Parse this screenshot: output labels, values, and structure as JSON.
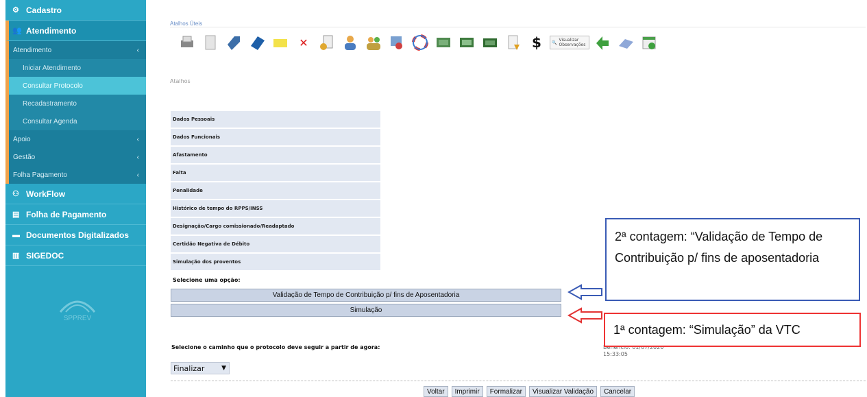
{
  "sidebar": {
    "cadastro": "Cadastro",
    "atendimento": "Atendimento",
    "sub_atendimento": "Atendimento",
    "iniciar": "Iniciar Atendimento",
    "consultar_protocolo": "Consultar Protocolo",
    "recadastramento": "Recadastramento",
    "consultar_agenda": "Consultar Agenda",
    "apoio": "Apoio",
    "gestao": "Gestão",
    "folha_pagamento_sub": "Folha Pagamento",
    "workflow": "WorkFlow",
    "folha_pagamento": "Folha de Pagamento",
    "documentos": "Documentos Digitalizados",
    "sigedoc": "SIGEDOC",
    "logo_text": "SPPREV"
  },
  "shortcuts": {
    "title": "Atalhos Úteis",
    "visualizar_label": "Visualizar Observações"
  },
  "atalhos_label": "Atalhos",
  "rows": [
    "Dados Pessoais",
    "Dados Funcionais",
    "Afastamento",
    "Falta",
    "Penalidade",
    "Histórico de tempo do RPPS/INSS",
    "Designação/Cargo comissionado/Readaptado",
    "Certidão Negativa de Débito",
    "Simulação dos proventos"
  ],
  "select_label": "Selecione uma opção:",
  "options": {
    "validacao": "Validação de Tempo de Contribuição p/ fins de Aposentadoria",
    "simulacao": "Simulação"
  },
  "path_label": "Selecione o caminho que o protocolo deve seguir a partir de agora:",
  "finalizar": "Finalizar",
  "date_text": "Benefício: 01/07/2020",
  "time_text": "15:33:05",
  "bottom_buttons": {
    "voltar": "Voltar",
    "imprimir": "Imprimir",
    "formalizar": "Formalizar",
    "visualizar_validacao": "Visualizar Validação",
    "cancelar": "Cancelar"
  },
  "annotations": {
    "blue_text": "2ª contagem: “Validação de Tempo de Contribuição p/ fins de aposentadoria",
    "red_text": "1ª contagem: “Simulação” da VTC",
    "blue_color": "#3a5bb5",
    "red_color": "#e33333"
  }
}
